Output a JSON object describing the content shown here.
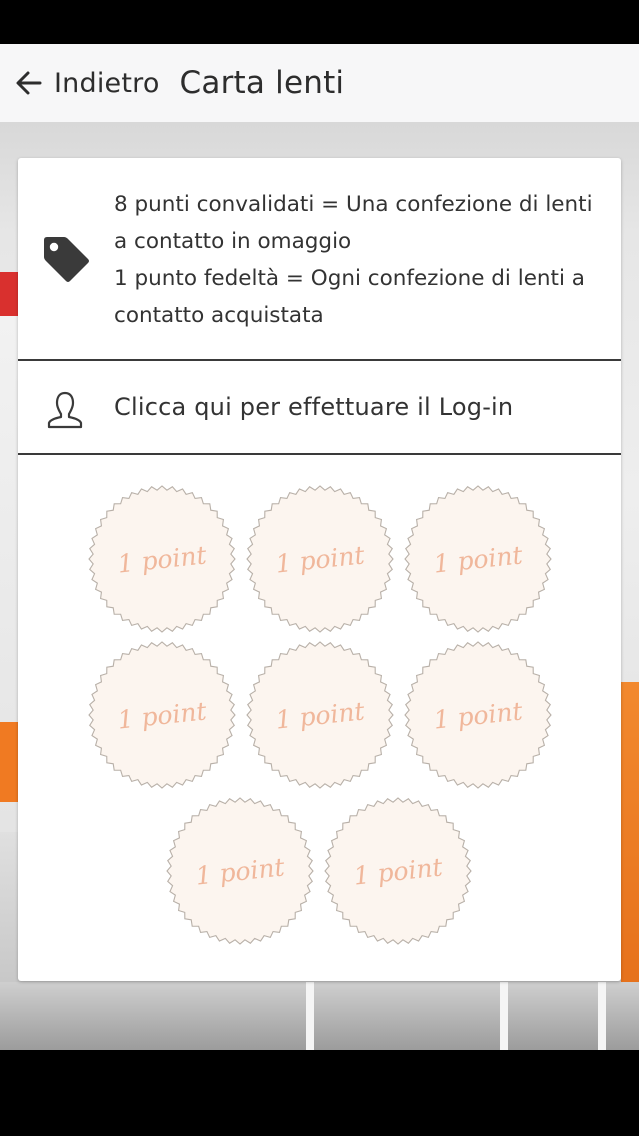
{
  "header": {
    "back_label": "Indietro",
    "title": "Carta lenti",
    "back_icon": "arrow-left-icon"
  },
  "info": {
    "icon": "tag-icon",
    "line1": "8 punti convalidati = Una confezione di lenti a contatto in omaggio",
    "line2": "1 punto fedeltà = Ogni confezione di lenti a contatto acquistata"
  },
  "login": {
    "icon": "user-icon",
    "label": "Clicca qui per effettuare il Log-in"
  },
  "stamps": [
    {
      "label": "1 point"
    },
    {
      "label": "1 point"
    },
    {
      "label": "1 point"
    },
    {
      "label": "1 point"
    },
    {
      "label": "1 point"
    },
    {
      "label": "1 point"
    },
    {
      "label": "1 point"
    },
    {
      "label": "1 point"
    }
  ],
  "colors": {
    "stamp_fill": "#fcf5ef",
    "stamp_border": "#b8b0a8",
    "stamp_text": "#f0b79b",
    "divider": "#3a3a3a",
    "accent_orange": "#f07a22"
  }
}
